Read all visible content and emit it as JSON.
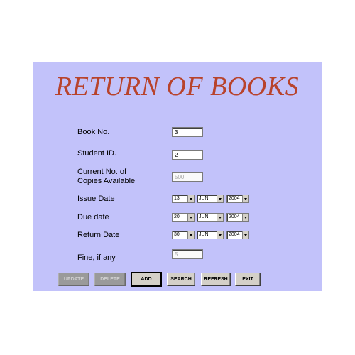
{
  "form": {
    "title": "RETURN OF BOOKS",
    "fields": {
      "book_no": {
        "label": "Book No.",
        "value": "3"
      },
      "student_id": {
        "label": "Student ID.",
        "value": "2"
      },
      "copies": {
        "label_line1": "Current No. of",
        "label_line2": "Copies Available",
        "value": "500"
      },
      "issue_date": {
        "label": "Issue Date",
        "day": "13",
        "month": "JUN",
        "year": "2004"
      },
      "due_date": {
        "label": "Due date",
        "day": "20",
        "month": "JUN",
        "year": "2004"
      },
      "return_date": {
        "label": "Return Date",
        "day": "30",
        "month": "JUN",
        "year": "2004"
      },
      "fine": {
        "label": "Fine, if any",
        "value": "5"
      }
    },
    "buttons": {
      "update": "UPDATE",
      "delete": "DELETE",
      "add": "ADD",
      "search": "SEARCH",
      "refresh": "REFRESH",
      "exit": "EXIT"
    }
  }
}
